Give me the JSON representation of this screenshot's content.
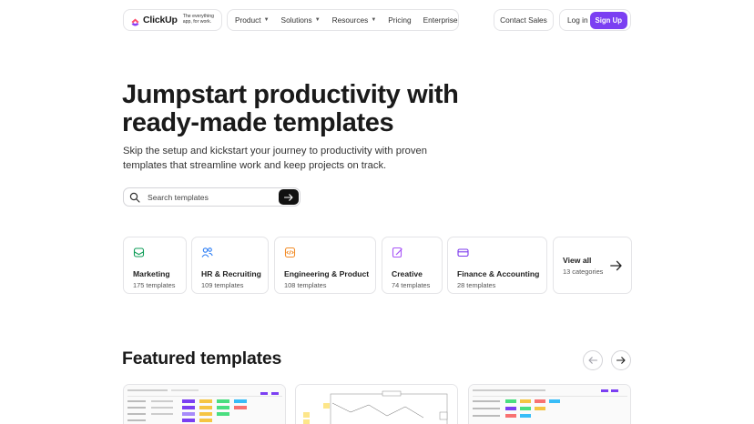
{
  "nav": {
    "logo_name": "ClickUp",
    "tagline": "The everything app, for work.",
    "menu": [
      {
        "label": "Product",
        "dropdown": true
      },
      {
        "label": "Solutions",
        "dropdown": true
      },
      {
        "label": "Resources",
        "dropdown": true
      },
      {
        "label": "Pricing",
        "dropdown": false
      },
      {
        "label": "Enterprise",
        "dropdown": false
      }
    ],
    "contact_sales": "Contact Sales",
    "login": "Log in",
    "signup": "Sign Up"
  },
  "hero": {
    "title": "Jumpstart productivity with ready-made templates",
    "subtitle": "Skip the setup and kickstart your journey to productivity with proven templates that streamline work and keep projects on track.",
    "search_placeholder": "Search templates"
  },
  "categories": [
    {
      "label": "Marketing",
      "count": "175 templates",
      "color": "#0f9d58",
      "icon": "mail-icon"
    },
    {
      "label": "HR & Recruiting",
      "count": "109 templates",
      "color": "#2f7ff5",
      "icon": "people-icon"
    },
    {
      "label": "Engineering & Product",
      "count": "108 templates",
      "color": "#f28c28",
      "icon": "code-icon"
    },
    {
      "label": "Creative",
      "count": "74 templates",
      "color": "#a855f7",
      "icon": "pen-icon"
    },
    {
      "label": "Finance & Accounting",
      "count": "28 templates",
      "color": "#7c3aed",
      "icon": "card-icon"
    }
  ],
  "view_all": {
    "label": "View all",
    "count": "13 categories"
  },
  "featured": {
    "title": "Featured templates"
  },
  "colors": {
    "brand": "#7b3ff2",
    "dark": "#111111",
    "border": "#e4e4e7"
  }
}
